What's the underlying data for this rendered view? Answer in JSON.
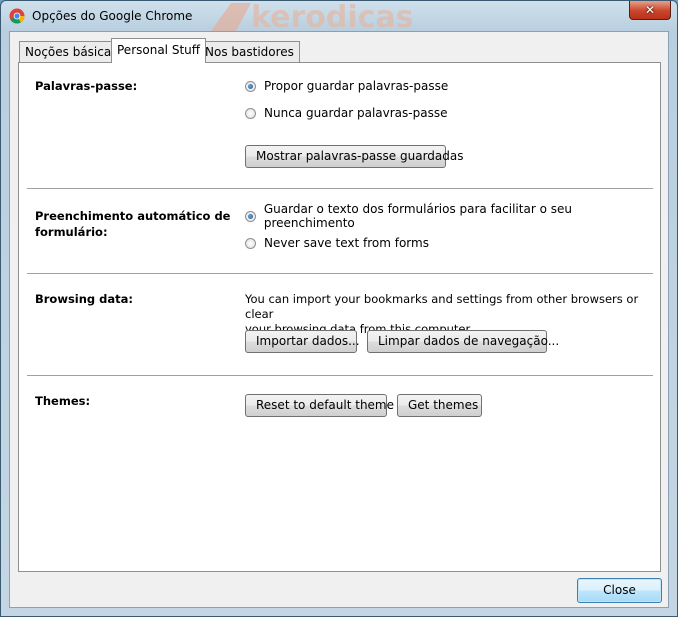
{
  "window": {
    "title": "Opções do Google Chrome",
    "close_symbol": "✕",
    "watermark": "kerodicas"
  },
  "tabs": [
    {
      "label": "Noções básicas",
      "active": false
    },
    {
      "label": "Personal Stuff",
      "active": true
    },
    {
      "label": "Nos bastidores",
      "active": false
    }
  ],
  "passwords": {
    "label": "Palavras-passe:",
    "options": [
      {
        "label": "Propor guardar palavras-passe",
        "checked": true
      },
      {
        "label": "Nunca guardar palavras-passe",
        "checked": false
      }
    ],
    "show_button": "Mostrar palavras-passe guardadas"
  },
  "autofill": {
    "label_line1": "Preenchimento automático de",
    "label_line2": "formulário:",
    "options": [
      {
        "label": "Guardar o texto dos formulários para facilitar o seu preenchimento",
        "checked": true
      },
      {
        "label": "Never save text from forms",
        "checked": false
      }
    ]
  },
  "browsing": {
    "label": "Browsing data:",
    "description_line1": "You can import your bookmarks and settings from other browsers or clear",
    "description_line2": "your browsing data from this computer.",
    "import_button": "Importar dados...",
    "clear_button": "Limpar dados de navegação..."
  },
  "themes": {
    "label": "Themes:",
    "reset_button": "Reset to default theme",
    "get_button": "Get themes"
  },
  "footer": {
    "close_button": "Close"
  },
  "colors": {
    "accent": "#3c7fb1",
    "titlebar": "#b9cfdf",
    "close_red": "#c9452b"
  }
}
